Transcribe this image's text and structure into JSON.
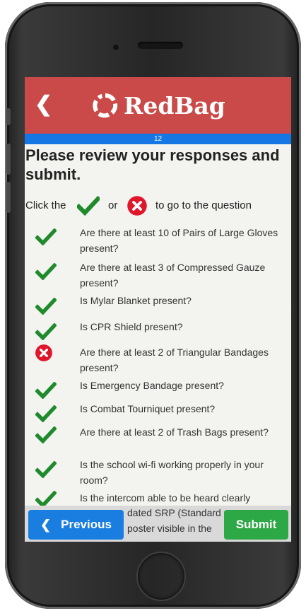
{
  "app": {
    "name": "RedBag",
    "progress_label": "12"
  },
  "review": {
    "title": "Please review your responses and submit.",
    "instruction_before": "Click the",
    "instruction_or": "or",
    "instruction_after": "to go to the question"
  },
  "questions": [
    {
      "text": "Are there at least 10 of Pairs of Large Gloves present?",
      "status": "check"
    },
    {
      "text": "Are there at least 3 of Compressed Gauze present?",
      "status": "check"
    },
    {
      "text": "Is Mylar Blanket present?",
      "status": "check"
    },
    {
      "text": "Is CPR Shield present?",
      "status": "check"
    },
    {
      "text": "Are there at least 2 of Triangular Bandages present?",
      "status": "x"
    },
    {
      "text": "Is Emergency Bandage present?",
      "status": "check"
    },
    {
      "text": "Is Combat Tourniquet present?",
      "status": "check"
    },
    {
      "text": "Are there at least 2 of Trash Bags present?",
      "status": "check"
    },
    {
      "text": "Is the school wi-fi working properly in your room?",
      "status": "check"
    },
    {
      "text": "Is the intercom able to be heard clearly",
      "status": "check"
    },
    {
      "text": "dated SRP (Standard",
      "status": "hidden"
    },
    {
      "text": "poster visible in the",
      "status": "hidden"
    }
  ],
  "buttons": {
    "previous": "Previous",
    "submit": "Submit"
  },
  "colors": {
    "header": "#c94a48",
    "progress": "#1677e4",
    "check": "#1f8a2c",
    "x": "#e0162b",
    "previous": "#1a7de0",
    "submit": "#2da846"
  }
}
